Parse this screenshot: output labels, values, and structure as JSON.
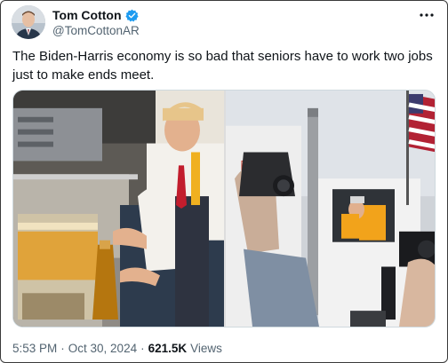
{
  "author": {
    "display_name": "Tom Cotton",
    "handle": "@TomCottonAR",
    "verified_icon": "verified-badge-icon",
    "avatar_icon": "avatar-photo"
  },
  "tweet": {
    "text": "The Biden-Harris economy is so bad that seniors have to work two jobs just to make ends meet."
  },
  "media": {
    "left_photo": "photo-fast-food-kitchen",
    "right_photo": "photo-garbage-truck-cab"
  },
  "footer": {
    "time": "5:53 PM",
    "separator": "·",
    "date": "Oct 30, 2024",
    "separator2": "·",
    "views_count": "621.5K",
    "views_label": "Views"
  },
  "colors": {
    "verified_blue": "#1d9bf0",
    "muted_text": "#536471",
    "primary_text": "#0f1419"
  }
}
